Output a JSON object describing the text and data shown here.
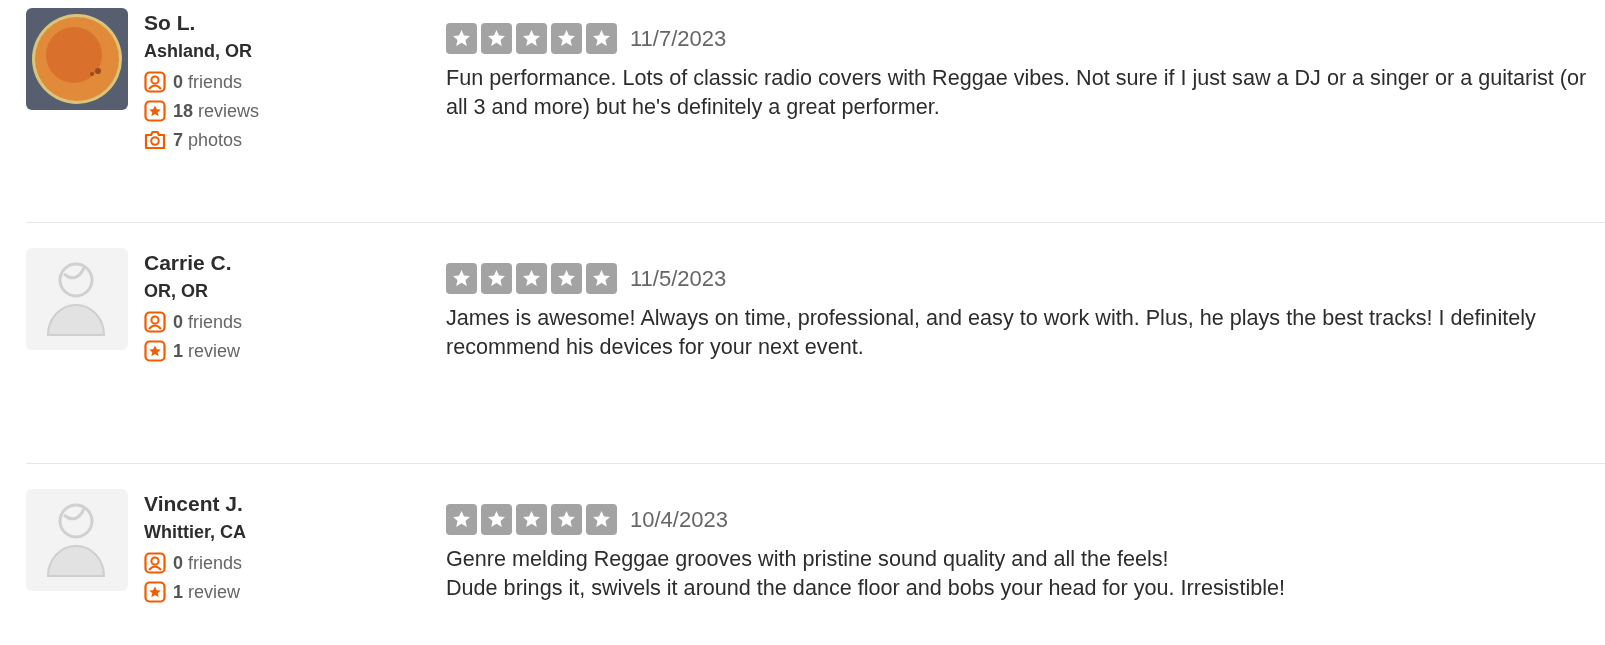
{
  "reviews": [
    {
      "name": "So L.",
      "location": "Ashland, OR",
      "stats": [
        {
          "kind": "friends",
          "text": "**0** friends"
        },
        {
          "kind": "reviews",
          "text": "**18** reviews"
        },
        {
          "kind": "photos",
          "text": "**7** photos"
        }
      ],
      "date": "11/7/2023",
      "text": "Fun performance. Lots of classic radio covers with Reggae vibes. Not sure if I just saw a DJ or a singer or a guitarist (or all 3 and more) but he's definitely a great performer."
    },
    {
      "avatar": {
        "kind": "default"
      },
      "name": "Carrie C.",
      "location": "OR, OR",
      "stats": [
        {
          "kind": "friends",
          "text": "**0** friends"
        },
        {
          "kind": "reviews",
          "text": "**1** review"
        }
      ],
      "date": "11/5/2023",
      "text": "James is awesome! Always on time, professional, and easy to work with. Plus, he plays the best tracks! I definitely recommend his devices for your next event."
    },
    {
      "avatar": {
        "kind": "default"
      },
      "name": "Vincent J.",
      "location": "Whittier, CA",
      "stats": [
        {
          "kind": "friends",
          "text": "**0** friends"
        },
        {
          "kind": "reviews",
          "text": "**1** review"
        }
      ],
      "date": "10/4/2023",
      "text": "Genre melding Reggae grooves with pristine sound quality and all the feels!\nDude brings it, swivels it around the dance floor and bobs your head for you. Irresistible!"
    }
  ]
}
